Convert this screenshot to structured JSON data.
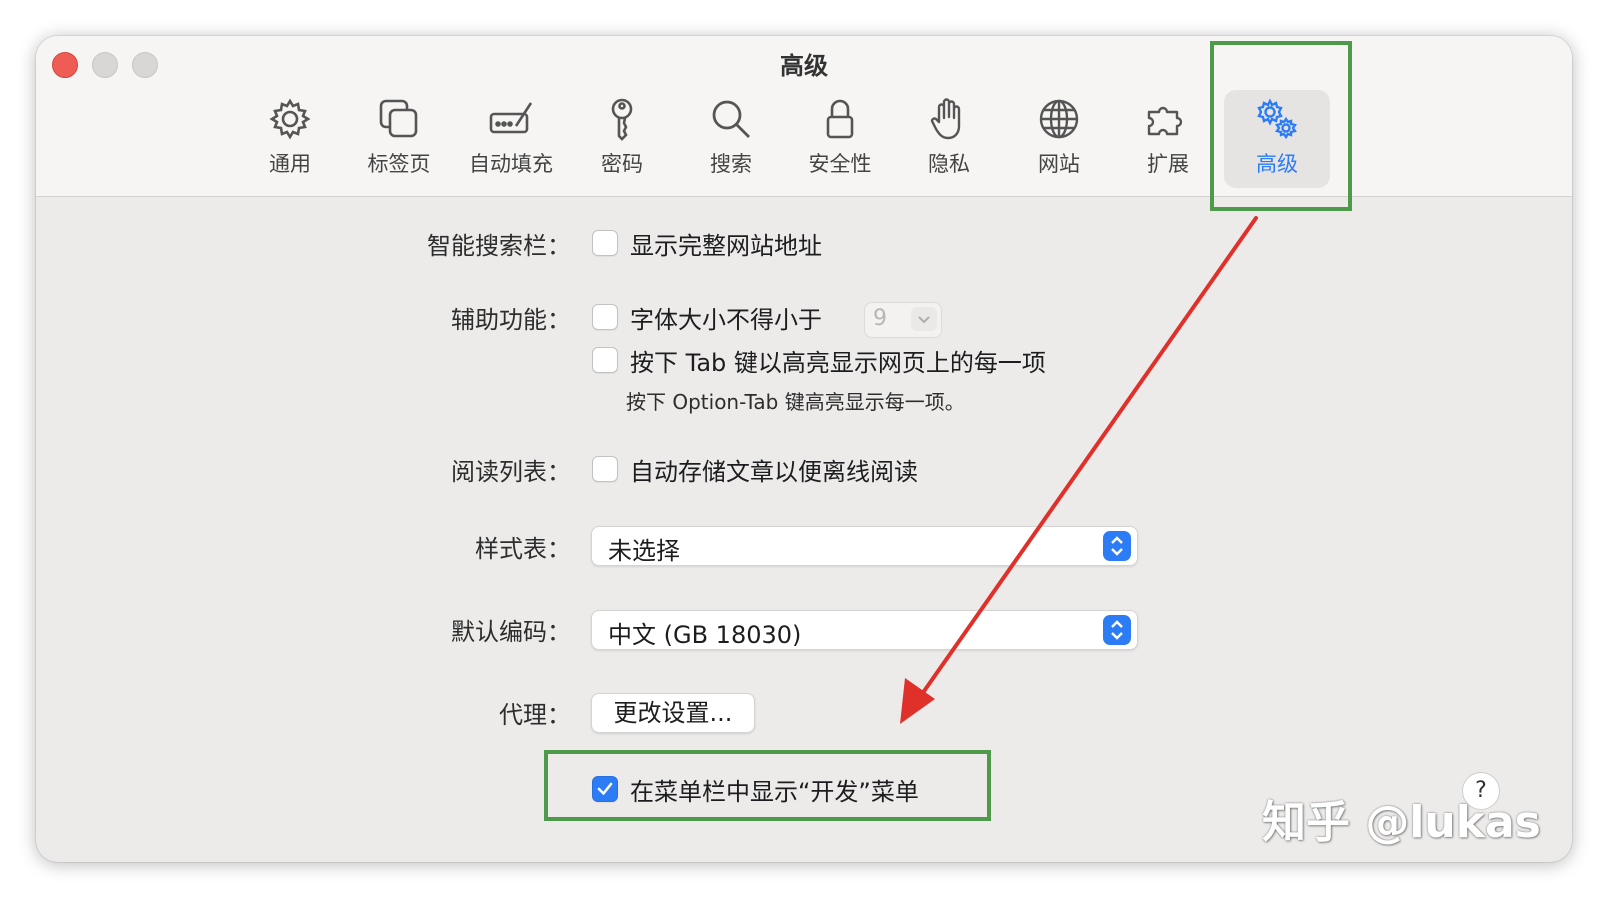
{
  "window": {
    "title": "高级"
  },
  "toolbar": {
    "tabs": [
      {
        "label": "通用",
        "icon": "gear-icon"
      },
      {
        "label": "标签页",
        "icon": "tabs-icon"
      },
      {
        "label": "自动填充",
        "icon": "autofill-icon"
      },
      {
        "label": "密码",
        "icon": "key-icon"
      },
      {
        "label": "搜索",
        "icon": "search-icon"
      },
      {
        "label": "安全性",
        "icon": "lock-icon"
      },
      {
        "label": "隐私",
        "icon": "hand-icon"
      },
      {
        "label": "网站",
        "icon": "globe-icon"
      },
      {
        "label": "扩展",
        "icon": "puzzle-icon"
      },
      {
        "label": "高级",
        "icon": "gears-icon",
        "selected": true
      }
    ]
  },
  "settings": {
    "smart_search": {
      "label": "智能搜索栏：",
      "option": "显示完整网站地址",
      "checked": false
    },
    "accessibility": {
      "label": "辅助功能：",
      "font_option": "字体大小不得小于",
      "font_size": "9",
      "tab_option": "按下 Tab 键以高亮显示网页上的每一项",
      "tab_hint": "按下 Option-Tab 键高亮显示每一项。"
    },
    "reading_list": {
      "label": "阅读列表：",
      "option": "自动存储文章以便离线阅读"
    },
    "stylesheet": {
      "label": "样式表：",
      "value": "未选择"
    },
    "encoding": {
      "label": "默认编码：",
      "value": "中文 (GB 18030)"
    },
    "proxy": {
      "label": "代理：",
      "button": "更改设置..."
    },
    "develop_menu": {
      "option": "在菜单栏中显示“开发”菜单",
      "checked": true
    }
  },
  "help": {
    "label": "?"
  },
  "watermark": "知乎 @lukas",
  "colors": {
    "accent": "#2c7cf6",
    "highlight_box": "#4c9a4a",
    "arrow": "#e0302a",
    "close": "#ee5c55"
  }
}
